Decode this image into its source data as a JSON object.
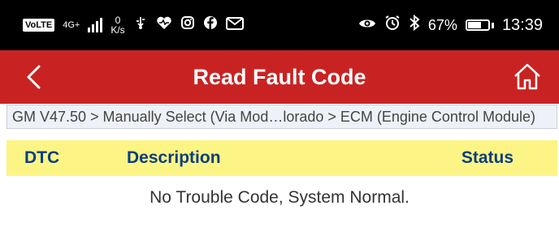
{
  "status_bar": {
    "volte": "VoLTE",
    "network": "4G+",
    "speed_value": "0",
    "speed_unit": "K/s",
    "battery": "67%",
    "battery_level": 0.67,
    "time": "13:39"
  },
  "app_bar": {
    "title": "Read Fault Code",
    "color": "#c82322"
  },
  "breadcrumb": "GM V47.50 > Manually Select (Via Mod…lorado > ECM (Engine Control Module)",
  "table": {
    "columns": [
      "DTC",
      "Description",
      "Status"
    ],
    "header_color": "#fcf585"
  },
  "message": "No Trouble Code, System Normal.",
  "icons": [
    "usb-icon",
    "heart-icon",
    "instagram-icon",
    "facebook-icon",
    "mail-icon",
    "eye-icon",
    "alarm-icon",
    "bluetooth-icon",
    "back-icon",
    "home-icon"
  ]
}
